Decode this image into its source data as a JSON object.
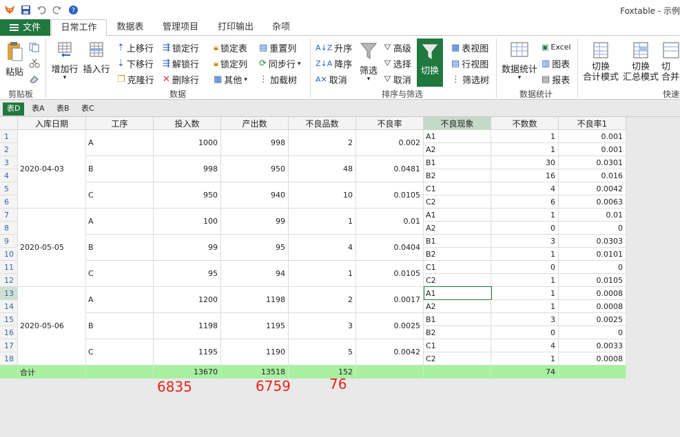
{
  "app": {
    "title": "Foxtable - 示例"
  },
  "colors": {
    "accent": "#20783f",
    "summary_row": "#a8f0a0",
    "annotation": "#e8231a"
  },
  "quick_access": [
    "app-logo-icon",
    "save-icon",
    "undo-icon",
    "redo-icon",
    "help-icon"
  ],
  "tabs": {
    "file": "文件",
    "items": [
      "日常工作",
      "数据表",
      "管理项目",
      "打印输出",
      "杂项"
    ],
    "active": "日常工作"
  },
  "ribbon": {
    "clipboard": {
      "label": "剪贴板",
      "paste": "粘贴"
    },
    "data": {
      "label": "数据",
      "add_row": "增加行",
      "insert_row": "插入行",
      "move_up": "上移行",
      "move_down": "下移行",
      "clone": "克隆行",
      "lock_row": "锁定行",
      "unlock_row": "解锁行",
      "delete_row": "删除行",
      "lock_table": "锁定表",
      "lock_col": "锁定列",
      "other": "其他",
      "reset_col": "重置列",
      "sync_row": "同步行",
      "load_tree": "加载树"
    },
    "sort_filter": {
      "label": "排序与筛选",
      "asc": "升序",
      "desc": "降序",
      "cancel": "取消",
      "filter": "筛选",
      "advanced": "高级",
      "select": "选择",
      "cancel2": "取消",
      "switch": "切换",
      "table_view": "表视图",
      "row_view": "行视图",
      "filter_tree": "筛选树"
    },
    "stats": {
      "label": "数据统计",
      "data_stats": "数据统计",
      "excel": "Excel",
      "chart": "图表",
      "report": "报表"
    },
    "quick": {
      "label": "快速",
      "total_mode_1": "切换",
      "total_mode_2": "合计模式",
      "summary_mode_1": "切换",
      "summary_mode_2": "汇总模式",
      "merge_1": "切",
      "merge_2": "合并"
    }
  },
  "sheets": {
    "items": [
      "表D",
      "表A",
      "表B",
      "表C"
    ],
    "active": "表D"
  },
  "table": {
    "columns": [
      "入库日期",
      "工序",
      "投入数",
      "产出数",
      "不良品数",
      "不良率",
      "不良现象",
      "不数数",
      "不良率1"
    ],
    "sorted_columns": [
      0,
      1,
      2,
      3,
      4,
      5
    ],
    "selected_column": 6,
    "groups": [
      {
        "date": "2020-04-03",
        "procs": [
          {
            "proc": "A",
            "input": "1000",
            "output": "998",
            "defects": "2",
            "rate": "0.002"
          },
          {
            "proc": "B",
            "input": "998",
            "output": "950",
            "defects": "48",
            "rate": "0.0481"
          },
          {
            "proc": "C",
            "input": "950",
            "output": "940",
            "defects": "10",
            "rate": "0.0105"
          }
        ]
      },
      {
        "date": "2020-05-05",
        "procs": [
          {
            "proc": "A",
            "input": "100",
            "output": "99",
            "defects": "1",
            "rate": "0.01"
          },
          {
            "proc": "B",
            "input": "99",
            "output": "95",
            "defects": "4",
            "rate": "0.0404"
          },
          {
            "proc": "C",
            "input": "95",
            "output": "94",
            "defects": "1",
            "rate": "0.0105"
          }
        ]
      },
      {
        "date": "2020-05-06",
        "procs": [
          {
            "proc": "A",
            "input": "1200",
            "output": "1198",
            "defects": "2",
            "rate": "0.0017"
          },
          {
            "proc": "B",
            "input": "1198",
            "output": "1195",
            "defects": "3",
            "rate": "0.0025"
          },
          {
            "proc": "C",
            "input": "1195",
            "output": "1190",
            "defects": "5",
            "rate": "0.0042"
          }
        ]
      }
    ],
    "detail_rows": [
      {
        "row": "1",
        "phen": "A1",
        "count": "1",
        "rate1": "0.001"
      },
      {
        "row": "2",
        "phen": "A2",
        "count": "1",
        "rate1": "0.001"
      },
      {
        "row": "3",
        "phen": "B1",
        "count": "30",
        "rate1": "0.0301"
      },
      {
        "row": "4",
        "phen": "B2",
        "count": "16",
        "rate1": "0.016"
      },
      {
        "row": "5",
        "phen": "C1",
        "count": "4",
        "rate1": "0.0042"
      },
      {
        "row": "6",
        "phen": "C2",
        "count": "6",
        "rate1": "0.0063"
      },
      {
        "row": "7",
        "phen": "A1",
        "count": "1",
        "rate1": "0.01"
      },
      {
        "row": "8",
        "phen": "A2",
        "count": "0",
        "rate1": "0"
      },
      {
        "row": "9",
        "phen": "B1",
        "count": "3",
        "rate1": "0.0303"
      },
      {
        "row": "10",
        "phen": "B2",
        "count": "1",
        "rate1": "0.0101"
      },
      {
        "row": "11",
        "phen": "C1",
        "count": "0",
        "rate1": "0"
      },
      {
        "row": "12",
        "phen": "C2",
        "count": "1",
        "rate1": "0.0105"
      },
      {
        "row": "13",
        "phen": "A1",
        "count": "1",
        "rate1": "0.0008"
      },
      {
        "row": "14",
        "phen": "A2",
        "count": "1",
        "rate1": "0.0008"
      },
      {
        "row": "15",
        "phen": "B1",
        "count": "3",
        "rate1": "0.0025"
      },
      {
        "row": "16",
        "phen": "B2",
        "count": "0",
        "rate1": "0"
      },
      {
        "row": "17",
        "phen": "C1",
        "count": "4",
        "rate1": "0.0033"
      },
      {
        "row": "18",
        "phen": "C2",
        "count": "1",
        "rate1": "0.0008"
      }
    ],
    "selected_row": 12,
    "summary": {
      "label": "合计",
      "input": "13670",
      "output": "13518",
      "defects": "152",
      "count": "74"
    }
  },
  "annotations": [
    "6835",
    "6759",
    "76"
  ]
}
